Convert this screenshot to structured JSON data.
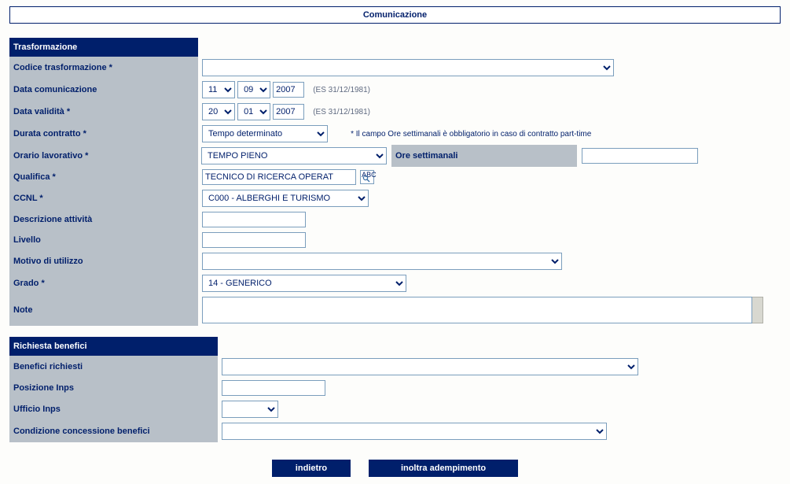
{
  "title": "Comunicazione",
  "sections": {
    "trasformazione": {
      "header": "Trasformazione",
      "codice_label": "Codice trasformazione *",
      "data_com_label": "Data comunicazione",
      "data_com_day": "11",
      "data_com_month": "09",
      "data_com_year": "2007",
      "data_val_label": "Data validità *",
      "data_val_day": "20",
      "data_val_month": "01",
      "data_val_year": "2007",
      "date_hint": "(ES 31/12/1981)",
      "durata_label": "Durata contratto *",
      "durata_value": "Tempo determinato",
      "durata_note": "* Il campo Ore settimanali è obbligatorio in caso di contratto part-time",
      "orario_label": "Orario lavorativo *",
      "orario_value": "TEMPO PIENO",
      "ore_label": "Ore settimanali",
      "ore_value": "",
      "qualifica_label": "Qualifica *",
      "qualifica_value": "TECNICO DI RICERCA OPERAT",
      "lookup_text": "ABC",
      "ccnl_label": "CCNL *",
      "ccnl_value": "C000 - ALBERGHI E TURISMO",
      "descr_label": "Descrizione attività",
      "descr_value": "",
      "livello_label": "Livello",
      "livello_value": "",
      "motivo_label": "Motivo di utilizzo",
      "grado_label": "Grado *",
      "grado_value": "14 - GENERICO",
      "note_label": "Note",
      "note_value": ""
    },
    "benefici": {
      "header": "Richiesta benefici",
      "richiesti_label": "Benefici richiesti",
      "posizione_label": "Posizione Inps",
      "posizione_value": "",
      "ufficio_label": "Ufficio Inps",
      "condizione_label": "Condizione concessione benefici"
    }
  },
  "buttons": {
    "back": "indietro",
    "submit": "inoltra adempimento"
  }
}
